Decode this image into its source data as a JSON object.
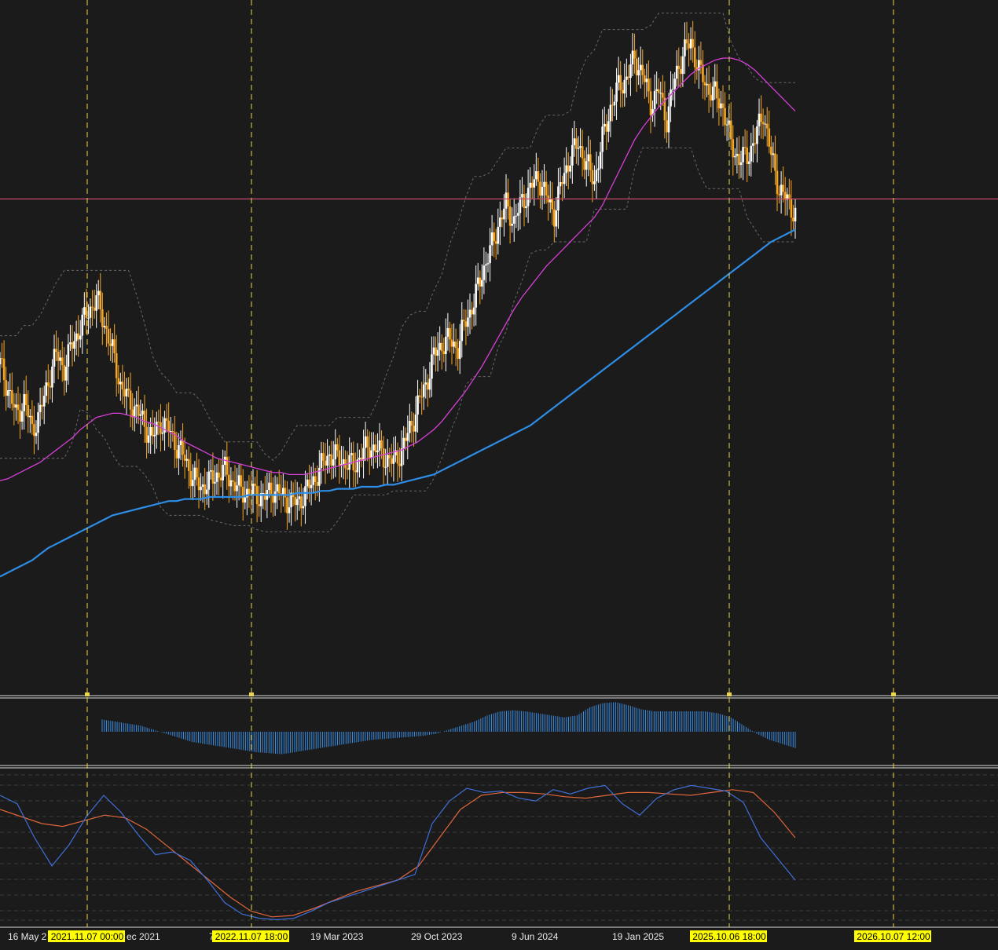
{
  "chart_data": {
    "type": "candlestick",
    "price_series": [
      160,
      148,
      135,
      142,
      128,
      136,
      152,
      165,
      158,
      170,
      178,
      186,
      192,
      180,
      166,
      150,
      142,
      138,
      130,
      124,
      132,
      128,
      120,
      114,
      104,
      100,
      102,
      106,
      108,
      102,
      98,
      97,
      96,
      95,
      99,
      96,
      93,
      92,
      97,
      103,
      110,
      116,
      114,
      112,
      110,
      116,
      120,
      118,
      114,
      112,
      118,
      128,
      140,
      150,
      164,
      170,
      172,
      168,
      182,
      190,
      205,
      215,
      228,
      238,
      230,
      240,
      246,
      252,
      242,
      234,
      250,
      262,
      268,
      258,
      250,
      270,
      286,
      296,
      300,
      310,
      302,
      288,
      294,
      280,
      300,
      312,
      318,
      304,
      296,
      292,
      286,
      268,
      260,
      262,
      270,
      284,
      262,
      246,
      240,
      234
    ],
    "ma50": [
      103,
      104,
      106,
      108,
      110,
      112,
      115,
      118,
      121,
      124,
      128,
      131,
      134,
      135,
      136,
      136,
      135,
      134,
      132,
      131,
      129,
      127,
      125,
      122,
      120,
      118,
      116,
      114,
      113,
      112,
      111,
      110,
      109,
      108,
      107,
      107,
      106,
      106,
      106,
      107,
      108,
      109,
      110,
      111,
      112,
      113,
      114,
      115,
      116,
      117,
      118,
      120,
      122,
      125,
      128,
      132,
      137,
      142,
      147,
      153,
      159,
      166,
      173,
      180,
      187,
      193,
      198,
      203,
      208,
      212,
      216,
      220,
      224,
      228,
      232,
      238,
      246,
      254,
      262,
      270,
      276,
      281,
      286,
      290,
      294,
      298,
      302,
      305,
      307,
      309,
      310,
      310,
      309,
      307,
      304,
      300,
      296,
      292,
      288,
      284
    ],
    "ma200": [
      56,
      58,
      60,
      62,
      64,
      67,
      70,
      72,
      74,
      76,
      78,
      80,
      82,
      84,
      86,
      87,
      88,
      89,
      90,
      91,
      92,
      93,
      93,
      94,
      94,
      94,
      95,
      95,
      95,
      95,
      95,
      96,
      96,
      96,
      96,
      96,
      96,
      97,
      97,
      97,
      98,
      98,
      99,
      99,
      99,
      100,
      100,
      100,
      101,
      101,
      102,
      103,
      104,
      105,
      106,
      108,
      110,
      112,
      114,
      116,
      118,
      120,
      122,
      124,
      126,
      128,
      130,
      133,
      136,
      139,
      142,
      145,
      148,
      151,
      154,
      157,
      160,
      163,
      166,
      169,
      172,
      175,
      178,
      181,
      184,
      187,
      190,
      193,
      196,
      199,
      202,
      205,
      208,
      211,
      214,
      217,
      220,
      222,
      224,
      226
    ],
    "horizontal_level": 241,
    "histogram_values": [
      0.6,
      0.5,
      0.4,
      0.3,
      0.1,
      -0.1,
      -0.3,
      -0.5,
      -0.6,
      -0.7,
      -0.8,
      -0.9,
      -1.0,
      -1.05,
      -1.1,
      -1.0,
      -0.9,
      -0.8,
      -0.7,
      -0.6,
      -0.5,
      -0.4,
      -0.35,
      -0.3,
      -0.25,
      -0.2,
      -0.1,
      0.1,
      0.3,
      0.5,
      0.8,
      1.0,
      1.05,
      1.0,
      0.9,
      0.8,
      0.7,
      0.8,
      1.2,
      1.4,
      1.45,
      1.3,
      1.1,
      1.0,
      1.0,
      1.0,
      1.0,
      1.0,
      0.9,
      0.7,
      0.3,
      -0.1,
      -0.4,
      -0.6,
      -0.8
    ],
    "stoch_k": [
      90,
      84,
      60,
      40,
      55,
      75,
      90,
      78,
      62,
      48,
      50,
      44,
      30,
      14,
      6,
      3,
      2,
      3,
      8,
      14,
      18,
      22,
      26,
      30,
      34,
      70,
      86,
      95,
      92,
      93,
      88,
      86,
      94,
      91,
      95,
      97,
      84,
      76,
      88,
      94,
      97,
      95,
      93,
      85,
      60,
      45,
      30
    ],
    "stoch_d": [
      80,
      75,
      70,
      68,
      72,
      76,
      74,
      66,
      54,
      42,
      30,
      18,
      8,
      4,
      5,
      10,
      16,
      22,
      26,
      30,
      40,
      60,
      80,
      90,
      92,
      92,
      91,
      89,
      88,
      90,
      92,
      92,
      91,
      90,
      92,
      94,
      92,
      78,
      60
    ],
    "x_tick_labels": [
      "16 May 2",
      "ec 2021",
      "7",
      "19 Mar 2023",
      "29 Oct 2023",
      "9 Jun 2024",
      "19 Jan 2025"
    ],
    "vertical_markers": [
      {
        "label": "2021.11.07 00:00"
      },
      {
        "label": "2022.11.07 18:00"
      },
      {
        "label": "2025.10.06 18:00"
      },
      {
        "label": "2026.10.07 12:00"
      }
    ],
    "colors": {
      "background": "#1b1b1b",
      "candle_up": "#ffffff",
      "candle_down": "#f5a623",
      "ma50": "#d63fd6",
      "ma200": "#2e8de6",
      "level_line": "#c94a6a",
      "markers": "#e8d44d",
      "histogram": "#3a8ee6",
      "stoch_k": "#3f6fd8",
      "stoch_d": "#e0663a",
      "bands": "#6a6a6a"
    }
  }
}
